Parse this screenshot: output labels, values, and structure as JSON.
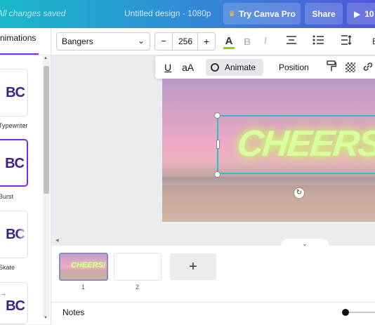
{
  "topbar": {
    "saved_status": "All changes saved",
    "doc_title": "Untitled design - 1080p",
    "try_pro_label": "Try Canva Pro",
    "share_label": "Share",
    "present_label": "10"
  },
  "toolbar": {
    "font_name": "Bangers",
    "font_size": "256",
    "minus": "−",
    "plus": "+",
    "text_color_glyph": "A",
    "bold_glyph": "B",
    "italic_glyph": "I",
    "effects_label": "E"
  },
  "toolbar2": {
    "underline_glyph": "U",
    "case_glyph": "aA",
    "animate_label": "Animate",
    "position_label": "Position"
  },
  "left_panel": {
    "tab_label": "Animations",
    "cards": [
      {
        "abc": "BC",
        "label": "Typewriter"
      },
      {
        "abc": "BC",
        "label": "Burst"
      },
      {
        "abc": "BC",
        "label": "Skate"
      },
      {
        "abc": "BC",
        "label": ""
      }
    ]
  },
  "canvas": {
    "text": "CHEERS!"
  },
  "pages": {
    "thumb_text": "CHEERS!",
    "numbers": [
      "1",
      "2"
    ],
    "add_glyph": "+"
  },
  "footer": {
    "notes_label": "Notes"
  },
  "colors": {
    "accent_purple": "#7d2ae8",
    "selection_cyan": "#26c0d3",
    "text_glow": "#d9fd9e"
  }
}
